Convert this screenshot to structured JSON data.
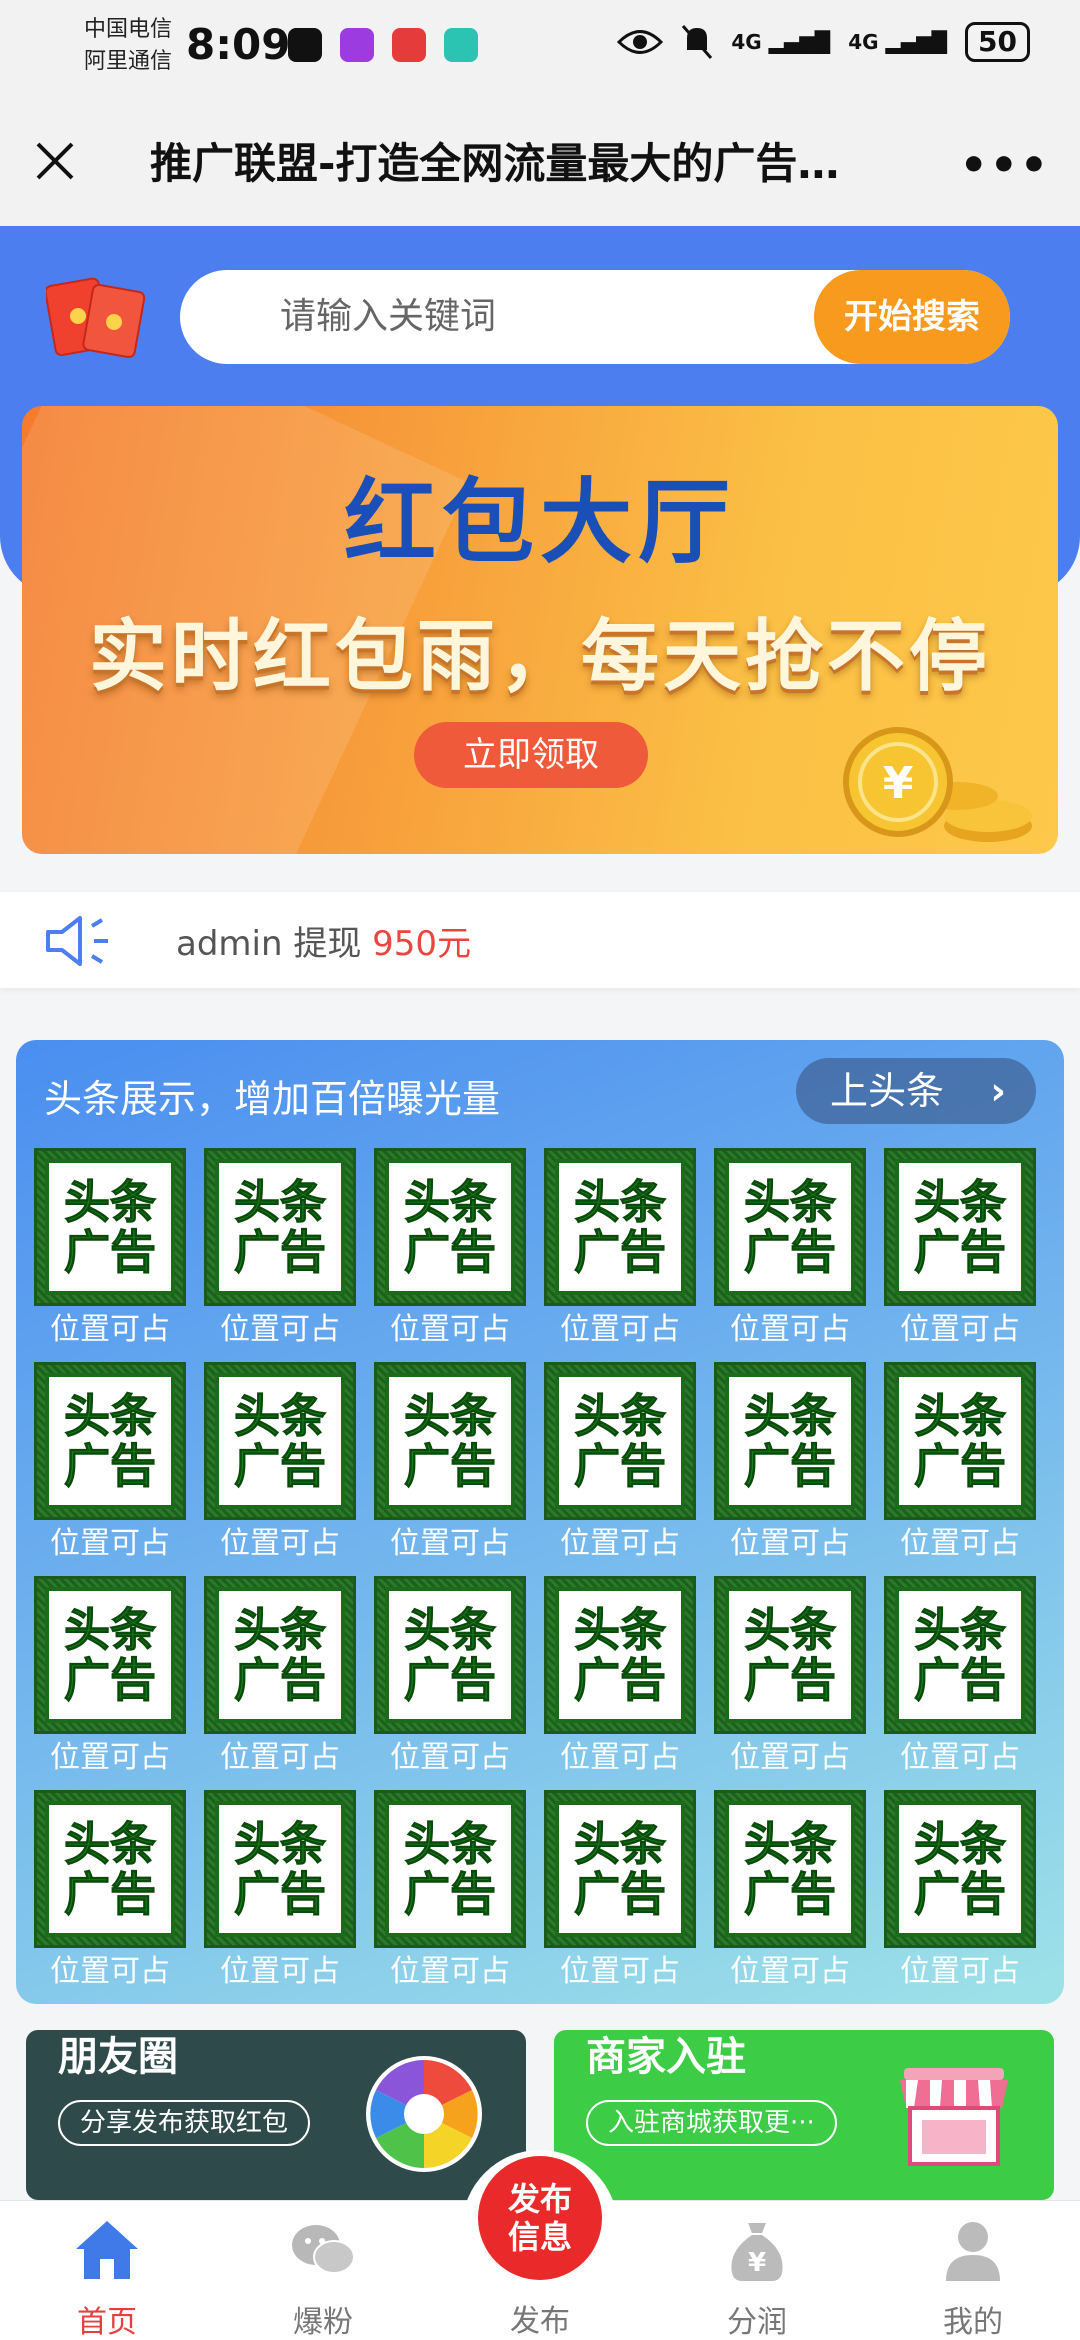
{
  "status_bar": {
    "carrier1": "中国电信",
    "carrier2": "阿里通信",
    "time": "8:09",
    "net1": "4G",
    "net2": "4G",
    "battery": "50"
  },
  "title_bar": {
    "title": "推广联盟-打造全网流量最大的广告…"
  },
  "search": {
    "placeholder": "请输入关键词",
    "button": "开始搜索"
  },
  "banner": {
    "title": "红包大厅",
    "subtitle": "实时红包雨，每天抢不停",
    "button": "立即领取"
  },
  "notice": {
    "user": "admin",
    "action": "提现",
    "amount": "950元"
  },
  "headline": {
    "title": "头条展示，增加百倍曝光量",
    "button": "上头条",
    "ad_line1": "头条",
    "ad_line2": "广告",
    "slots": [
      "位置可占",
      "位置可占",
      "位置可占",
      "位置可占",
      "位置可占",
      "位置可占",
      "位置可占",
      "位置可占",
      "位置可占",
      "位置可占",
      "位置可占",
      "位置可占",
      "位置可占",
      "位置可占",
      "位置可占",
      "位置可占",
      "位置可占",
      "位置可占",
      "位置可占",
      "位置可占",
      "位置可占",
      "位置可占",
      "位置可占",
      "位置可占"
    ]
  },
  "cards": {
    "moments": {
      "title": "朋友圈",
      "pill": "分享发布获取红包"
    },
    "merchant": {
      "title": "商家入驻",
      "pill": "入驻商城获取更···"
    }
  },
  "nav": {
    "home": "首页",
    "fans": "爆粉",
    "publish_btn": "发布信息",
    "publish": "发布",
    "share": "分润",
    "mine": "我的"
  },
  "colors": {
    "primary_blue": "#4d7ef0",
    "search_orange": "#f79a1e",
    "publish_red": "#ea2a2a",
    "amount_red": "#e8463f",
    "nav_active": "#e54040"
  }
}
